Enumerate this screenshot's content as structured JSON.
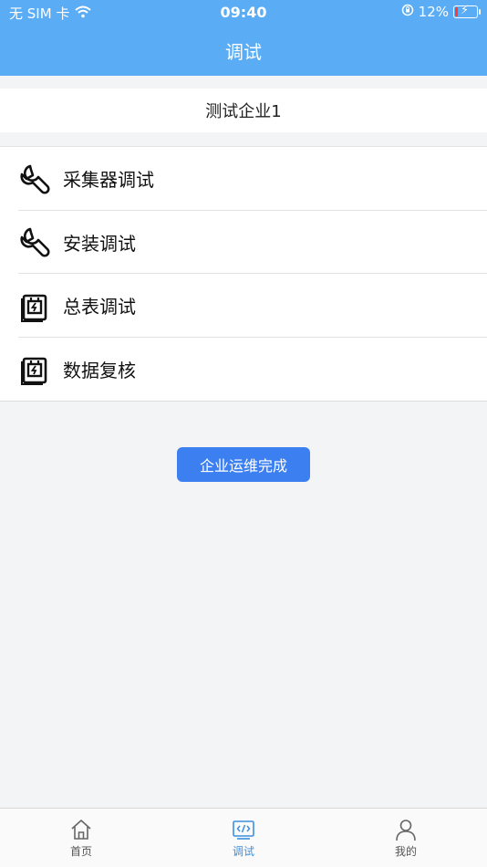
{
  "status_bar": {
    "carrier": "无 SIM 卡",
    "time": "09:40",
    "battery_percent": "12%",
    "battery_level": 0.12
  },
  "header": {
    "title": "调试"
  },
  "company": {
    "name": "测试企业1"
  },
  "menu": {
    "items": [
      {
        "label": "采集器调试",
        "icon": "wrench-icon"
      },
      {
        "label": "安装调试",
        "icon": "wrench-icon"
      },
      {
        "label": "总表调试",
        "icon": "meter-icon"
      },
      {
        "label": "数据复核",
        "icon": "meter-icon"
      }
    ]
  },
  "actions": {
    "complete_label": "企业运维完成"
  },
  "tabbar": {
    "tabs": [
      {
        "label": "首页",
        "icon": "home-icon"
      },
      {
        "label": "调试",
        "icon": "code-icon",
        "active": true
      },
      {
        "label": "我的",
        "icon": "user-icon"
      }
    ]
  },
  "colors": {
    "header_bg": "#5aacf5",
    "primary_button": "#3b7ff0",
    "tab_active": "#3d8fe0",
    "page_bg": "#f3f4f6"
  }
}
